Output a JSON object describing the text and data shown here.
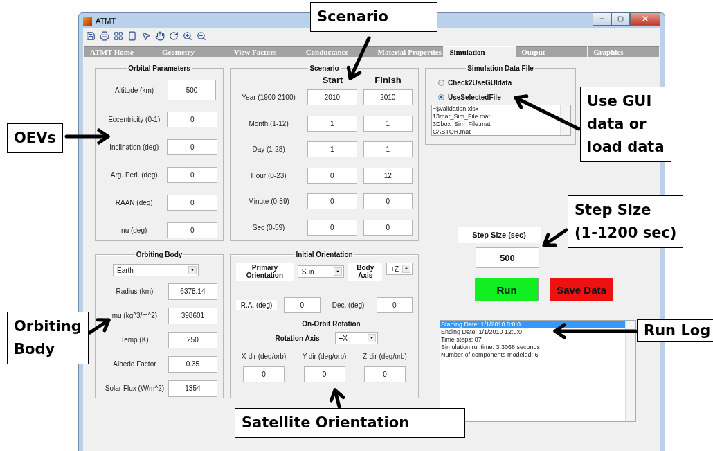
{
  "window": {
    "title": "ATMT"
  },
  "tabs": [
    {
      "label": "ATMT Home",
      "selected": false
    },
    {
      "label": "Geometry",
      "selected": false
    },
    {
      "label": "View Factors",
      "selected": false
    },
    {
      "label": "Conductance",
      "selected": false
    },
    {
      "label": "Material Properties",
      "selected": false
    },
    {
      "label": "Simulation",
      "selected": true
    },
    {
      "label": "Output",
      "selected": false
    },
    {
      "label": "Graphics",
      "selected": false
    }
  ],
  "orbital_parameters": {
    "title": "Orbital Parameters",
    "fields": [
      {
        "label": "Altitude (km)",
        "value": "500"
      },
      {
        "label": "Eccentricity (0-1)",
        "value": "0"
      },
      {
        "label": "Inclination (deg)",
        "value": "0"
      },
      {
        "label": "Arg. Peri. (deg)",
        "value": "0"
      },
      {
        "label": "RAAN (deg)",
        "value": "0"
      },
      {
        "label": "nu (deg)",
        "value": "0"
      }
    ]
  },
  "scenario": {
    "title": "Scenario",
    "column_headers": [
      "Start",
      "Finish"
    ],
    "rows": [
      {
        "label": "Year (1900-2100)",
        "start": "2010",
        "finish": "2010"
      },
      {
        "label": "Month (1-12)",
        "start": "1",
        "finish": "1"
      },
      {
        "label": "Day (1-28)",
        "start": "1",
        "finish": "1"
      },
      {
        "label": "Hour (0-23)",
        "start": "0",
        "finish": "12"
      },
      {
        "label": "Minute (0-59)",
        "start": "0",
        "finish": "0"
      },
      {
        "label": "Sec (0-59)",
        "start": "0",
        "finish": "0"
      }
    ]
  },
  "simulation_data_file": {
    "title": "Simulation Data File",
    "options": [
      {
        "label": "Check2UseGUIdata",
        "selected": false
      },
      {
        "label": "UseSelectedFile",
        "selected": true
      }
    ],
    "files": [
      "~$validation.xlsx",
      "13mar_Sim_File.mat",
      "3Dbox_Sim_File.mat",
      "CASTOR.mat"
    ]
  },
  "orbiting_body": {
    "title": "Orbiting Body",
    "body": "Earth",
    "fields": [
      {
        "label": "Radius (km)",
        "value": "6378.14"
      },
      {
        "label": "mu (kg^3/m^2)",
        "value": "398601"
      },
      {
        "label": "Temp (K)",
        "value": "250"
      },
      {
        "label": "Albedo Factor",
        "value": "0.35"
      },
      {
        "label": "Solar Flux (W/m^2)",
        "value": "1354"
      }
    ]
  },
  "initial_orientation": {
    "title": "Initial Orientation",
    "primary_label": "Primary Orientation",
    "primary_value": "Sun",
    "body_axis_label": "Body Axis",
    "body_axis_value": "+Z",
    "ra_label": "R.A. (deg)",
    "ra_value": "0",
    "dec_label": "Dec. (deg)",
    "dec_value": "0",
    "rotation_title": "On-Orbit Rotation",
    "rotation_axis_label": "Rotation Axis",
    "rotation_axis_value": "+X",
    "rates": [
      {
        "label": "X-dir (deg/orb)",
        "value": "0"
      },
      {
        "label": "Y-dir (deg/orb)",
        "value": "0"
      },
      {
        "label": "Z-dir (deg/orb)",
        "value": "0"
      }
    ]
  },
  "step_size": {
    "label": "Step Size (sec)",
    "value": "500"
  },
  "buttons": [
    {
      "label": "Run",
      "kind": "run"
    },
    {
      "label": "Save Data",
      "kind": "save"
    }
  ],
  "run_log": [
    {
      "text": "Starting Date: 1/1/2010  0:0:0",
      "selected": true
    },
    {
      "text": "Ending Date: 1/1/2010  12:0:0",
      "selected": false
    },
    {
      "text": "Time steps: 87",
      "selected": false
    },
    {
      "text": "Simulation runtime: 3.3068 seconds",
      "selected": false
    },
    {
      "text": "Number of components modeled: 6",
      "selected": false
    }
  ],
  "annotations": [
    {
      "text": "Scenario"
    },
    {
      "text": "OEVs"
    },
    {
      "text": "Use GUI\ndata or\nload data"
    },
    {
      "text": "Step Size\n(1-1200 sec)"
    },
    {
      "text": "Orbiting\nBody"
    },
    {
      "text": "Run Log"
    },
    {
      "text": "Satellite Orientation"
    }
  ]
}
